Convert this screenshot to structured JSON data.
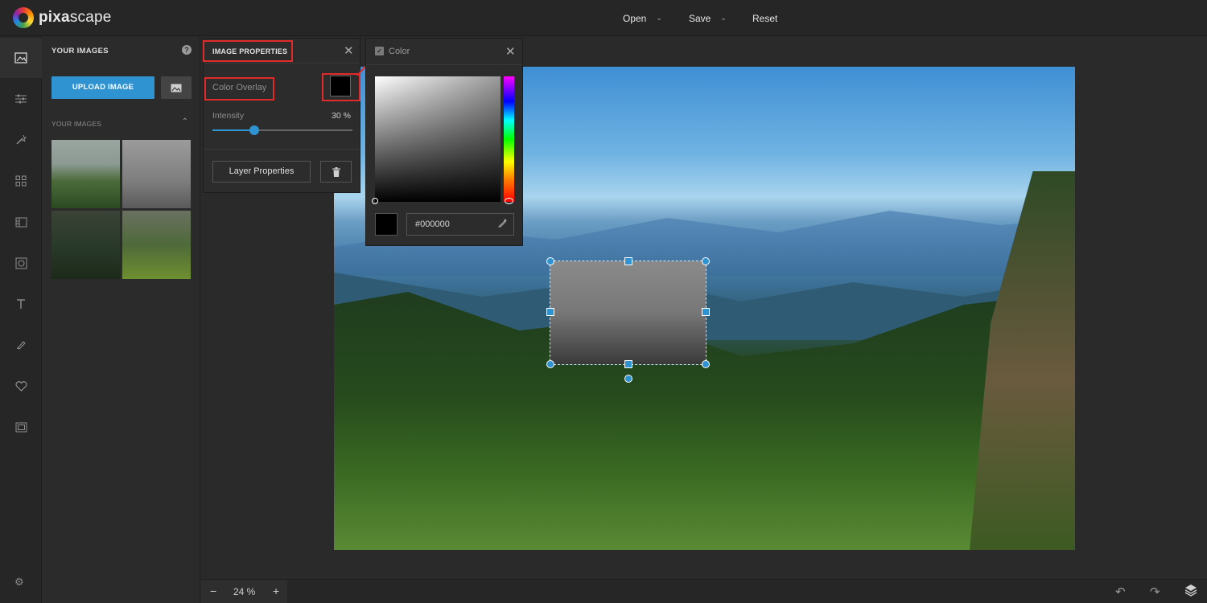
{
  "app": {
    "name_bold": "pixa",
    "name_rest": "scape"
  },
  "topmenu": {
    "open": "Open",
    "save": "Save",
    "reset": "Reset"
  },
  "panel": {
    "title": "YOUR IMAGES",
    "upload_label": "UPLOAD IMAGE",
    "section_title": "YOUR IMAGES"
  },
  "properties": {
    "title": "IMAGE PROPERTIES",
    "color_overlay_label": "Color Overlay",
    "overlay_color": "#000000",
    "intensity_label": "Intensity",
    "intensity_value": 30,
    "intensity_display": "30 %",
    "layer_button": "Layer Properties"
  },
  "color_panel": {
    "title": "Color",
    "hex_value": "#000000"
  },
  "zoom": {
    "value": "24 %"
  },
  "colors": {
    "accent": "#2f93d2",
    "highlight": "#e12a2a"
  }
}
